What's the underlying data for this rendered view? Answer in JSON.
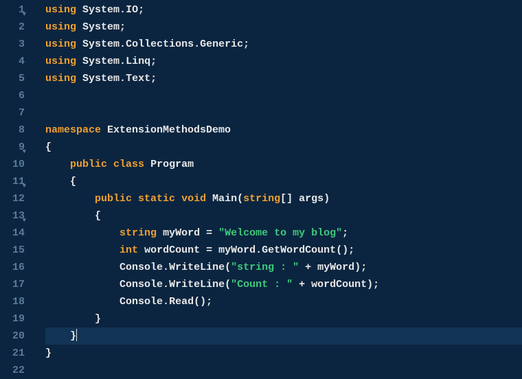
{
  "editor": {
    "language": "csharp",
    "activeLine": 20,
    "lines": [
      {
        "n": 1,
        "fold": true,
        "indent": 0,
        "tokens": [
          [
            "kw",
            "using"
          ],
          [
            "punct",
            " "
          ],
          [
            "ident",
            "System"
          ],
          [
            "punct",
            "."
          ],
          [
            "ident",
            "IO"
          ],
          [
            "punct",
            ";"
          ]
        ]
      },
      {
        "n": 2,
        "fold": false,
        "indent": 0,
        "tokens": [
          [
            "kw",
            "using"
          ],
          [
            "punct",
            " "
          ],
          [
            "ident",
            "System"
          ],
          [
            "punct",
            ";"
          ]
        ]
      },
      {
        "n": 3,
        "fold": false,
        "indent": 0,
        "tokens": [
          [
            "kw",
            "using"
          ],
          [
            "punct",
            " "
          ],
          [
            "ident",
            "System"
          ],
          [
            "punct",
            "."
          ],
          [
            "ident",
            "Collections"
          ],
          [
            "punct",
            "."
          ],
          [
            "ident",
            "Generic"
          ],
          [
            "punct",
            ";"
          ]
        ]
      },
      {
        "n": 4,
        "fold": false,
        "indent": 0,
        "tokens": [
          [
            "kw",
            "using"
          ],
          [
            "punct",
            " "
          ],
          [
            "ident",
            "System"
          ],
          [
            "punct",
            "."
          ],
          [
            "ident",
            "Linq"
          ],
          [
            "punct",
            ";"
          ]
        ]
      },
      {
        "n": 5,
        "fold": false,
        "indent": 0,
        "tokens": [
          [
            "kw",
            "using"
          ],
          [
            "punct",
            " "
          ],
          [
            "ident",
            "System"
          ],
          [
            "punct",
            "."
          ],
          [
            "ident",
            "Text"
          ],
          [
            "punct",
            ";"
          ]
        ]
      },
      {
        "n": 6,
        "fold": false,
        "indent": 0,
        "tokens": []
      },
      {
        "n": 7,
        "fold": false,
        "indent": 0,
        "tokens": []
      },
      {
        "n": 8,
        "fold": false,
        "indent": 0,
        "tokens": [
          [
            "kw",
            "namespace"
          ],
          [
            "punct",
            " "
          ],
          [
            "ident",
            "ExtensionMethodsDemo"
          ]
        ]
      },
      {
        "n": 9,
        "fold": true,
        "indent": 0,
        "tokens": [
          [
            "punct",
            "{"
          ]
        ]
      },
      {
        "n": 10,
        "fold": false,
        "indent": 1,
        "tokens": [
          [
            "kw",
            "public"
          ],
          [
            "punct",
            " "
          ],
          [
            "kw",
            "class"
          ],
          [
            "punct",
            " "
          ],
          [
            "ident",
            "Program"
          ]
        ]
      },
      {
        "n": 11,
        "fold": true,
        "indent": 1,
        "tokens": [
          [
            "punct",
            "{"
          ]
        ]
      },
      {
        "n": 12,
        "fold": false,
        "indent": 2,
        "tokens": [
          [
            "kw",
            "public"
          ],
          [
            "punct",
            " "
          ],
          [
            "kw",
            "static"
          ],
          [
            "punct",
            " "
          ],
          [
            "kw",
            "void"
          ],
          [
            "punct",
            " "
          ],
          [
            "method",
            "Main"
          ],
          [
            "punct",
            "("
          ],
          [
            "type",
            "string"
          ],
          [
            "punct",
            "[] "
          ],
          [
            "ident",
            "args"
          ],
          [
            "punct",
            ")"
          ]
        ]
      },
      {
        "n": 13,
        "fold": true,
        "indent": 2,
        "tokens": [
          [
            "punct",
            "{"
          ]
        ]
      },
      {
        "n": 14,
        "fold": false,
        "indent": 3,
        "tokens": [
          [
            "type",
            "string"
          ],
          [
            "punct",
            " "
          ],
          [
            "ident",
            "myWord"
          ],
          [
            "punct",
            " "
          ],
          [
            "op",
            "="
          ],
          [
            "punct",
            " "
          ],
          [
            "str",
            "\"Welcome to my blog\""
          ],
          [
            "punct",
            ";"
          ]
        ]
      },
      {
        "n": 15,
        "fold": false,
        "indent": 3,
        "tokens": [
          [
            "type",
            "int"
          ],
          [
            "punct",
            " "
          ],
          [
            "ident",
            "wordCount"
          ],
          [
            "punct",
            " "
          ],
          [
            "op",
            "="
          ],
          [
            "punct",
            " "
          ],
          [
            "ident",
            "myWord"
          ],
          [
            "punct",
            "."
          ],
          [
            "method",
            "GetWordCount"
          ],
          [
            "punct",
            "();"
          ]
        ]
      },
      {
        "n": 16,
        "fold": false,
        "indent": 3,
        "tokens": [
          [
            "ident",
            "Console"
          ],
          [
            "punct",
            "."
          ],
          [
            "method",
            "WriteLine"
          ],
          [
            "punct",
            "("
          ],
          [
            "str",
            "\"string : \""
          ],
          [
            "punct",
            " "
          ],
          [
            "op",
            "+"
          ],
          [
            "punct",
            " "
          ],
          [
            "ident",
            "myWord"
          ],
          [
            "punct",
            ");"
          ]
        ]
      },
      {
        "n": 17,
        "fold": false,
        "indent": 3,
        "tokens": [
          [
            "ident",
            "Console"
          ],
          [
            "punct",
            "."
          ],
          [
            "method",
            "WriteLine"
          ],
          [
            "punct",
            "("
          ],
          [
            "str",
            "\"Count : \""
          ],
          [
            "punct",
            " "
          ],
          [
            "op",
            "+"
          ],
          [
            "punct",
            " "
          ],
          [
            "ident",
            "wordCount"
          ],
          [
            "punct",
            ");"
          ]
        ]
      },
      {
        "n": 18,
        "fold": false,
        "indent": 3,
        "tokens": [
          [
            "ident",
            "Console"
          ],
          [
            "punct",
            "."
          ],
          [
            "method",
            "Read"
          ],
          [
            "punct",
            "();"
          ]
        ]
      },
      {
        "n": 19,
        "fold": false,
        "indent": 2,
        "tokens": [
          [
            "punct",
            "}"
          ]
        ]
      },
      {
        "n": 20,
        "fold": false,
        "indent": 1,
        "tokens": [
          [
            "punct",
            "}"
          ]
        ],
        "cursor": true
      },
      {
        "n": 21,
        "fold": false,
        "indent": 0,
        "tokens": [
          [
            "punct",
            "}"
          ]
        ]
      },
      {
        "n": 22,
        "fold": false,
        "indent": 0,
        "tokens": []
      }
    ],
    "indentSize": 4,
    "indentGuidesAt": [
      1,
      2,
      3
    ]
  }
}
